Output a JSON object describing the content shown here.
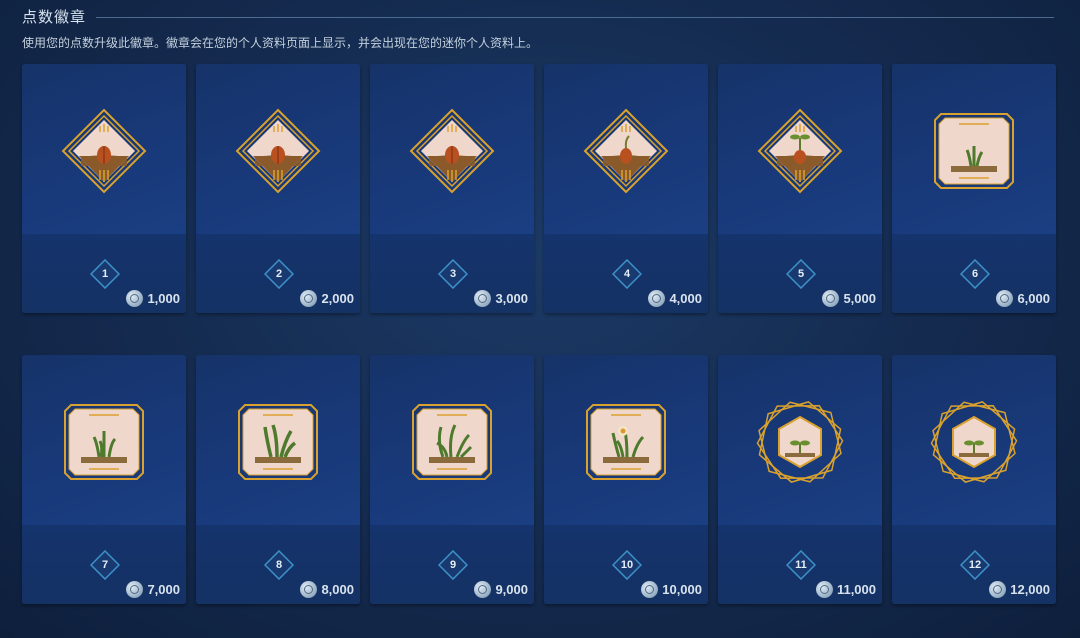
{
  "header": {
    "title": "点数徽章",
    "subtitle": "使用您的点数升级此徽章。徽章会在您的个人资料页面上显示，并会出现在您的迷你个人资料上。"
  },
  "badges": [
    {
      "level": "1",
      "cost": "1,000",
      "frame": "diamond",
      "plant": "seed"
    },
    {
      "level": "2",
      "cost": "2,000",
      "frame": "diamond",
      "plant": "seed"
    },
    {
      "level": "3",
      "cost": "3,000",
      "frame": "diamond",
      "plant": "seed"
    },
    {
      "level": "4",
      "cost": "4,000",
      "frame": "diamond",
      "plant": "sprout"
    },
    {
      "level": "5",
      "cost": "5,000",
      "frame": "diamond",
      "plant": "seedling"
    },
    {
      "level": "6",
      "cost": "6,000",
      "frame": "octagon",
      "plant": "grass-small"
    },
    {
      "level": "7",
      "cost": "7,000",
      "frame": "octagon",
      "plant": "grass"
    },
    {
      "level": "8",
      "cost": "8,000",
      "frame": "octagon",
      "plant": "grass-tall"
    },
    {
      "level": "9",
      "cost": "9,000",
      "frame": "octagon",
      "plant": "grass-curl"
    },
    {
      "level": "10",
      "cost": "10,000",
      "frame": "octagon",
      "plant": "flower"
    },
    {
      "level": "11",
      "cost": "11,000",
      "frame": "hexagon",
      "plant": "sprout-small"
    },
    {
      "level": "12",
      "cost": "12,000",
      "frame": "hexagon",
      "plant": "sprout-small"
    }
  ],
  "icons": {
    "coin": "steam-points-coin-icon",
    "level": "level-diamond-icon"
  },
  "colors": {
    "gold": "#d9a12e",
    "level_border": "#3d93c9",
    "card_bg": "#17396f"
  }
}
